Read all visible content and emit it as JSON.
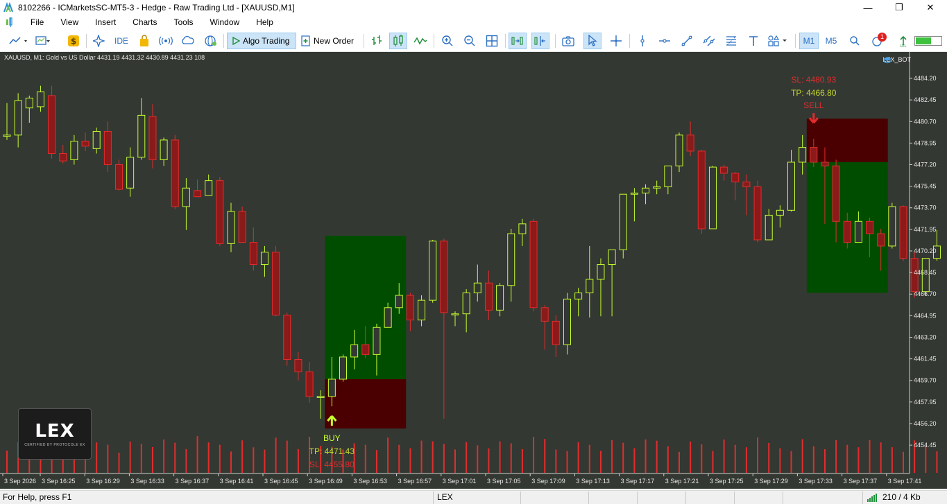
{
  "window": {
    "title": "8102266 - ICMarketsSC-MT5-3 - Hedge - Raw Trading Ltd - [XAUUSD,M1]",
    "minimize": "—",
    "maximize": "❐",
    "close": "✕"
  },
  "menu": {
    "items": [
      "File",
      "View",
      "Insert",
      "Charts",
      "Tools",
      "Window",
      "Help"
    ]
  },
  "toolbar": {
    "ide_label": "IDE",
    "algo_trading_label": "Algo Trading",
    "new_order_label": "New Order",
    "timeframe_m1": "M1",
    "timeframe_m5": "M5",
    "notification_count": "1",
    "accent_active": "#cce4f7"
  },
  "chart": {
    "info": "XAUUSD, M1:  Gold vs US Dollar  4431.19 4431.32 4430.89 4431.23  108",
    "expert_label": "LEX_BOT",
    "logo_word": "LEX",
    "logo_sub": "CERTIFIED BY PROTOCOLE EX",
    "buy_signal": {
      "label": "BUY",
      "tp": "TP: 4471.43",
      "sl": "SL: 4455.80"
    },
    "sell_signal": {
      "label": "SELL",
      "tp": "TP: 4466.80",
      "sl": "SL: 4480.93"
    },
    "colors": {
      "background": "#343832",
      "bull_candle": "#c6ff2f",
      "bear_candle": "#e12d2d",
      "volume": "#e12d2d",
      "profit_zone": "#004d00",
      "loss_zone": "#4a0000"
    }
  },
  "chart_data": {
    "type": "candlestick",
    "symbol": "XAUUSD",
    "timeframe": "M1",
    "ylim": [
      4453.5,
      4485.1
    ],
    "y_ticks": [
      "4484.20",
      "4482.45",
      "4480.70",
      "4478.95",
      "4477.20",
      "4475.45",
      "4473.70",
      "4471.95",
      "4470.20",
      "4468.45",
      "4466.70",
      "4464.95",
      "4463.20",
      "4461.45",
      "4459.70",
      "4457.95",
      "4456.20",
      "4454.45"
    ],
    "x_ticks": [
      "3 Sep 2026",
      "3 Sep 16:25",
      "3 Sep 16:29",
      "3 Sep 16:33",
      "3 Sep 16:37",
      "3 Sep 16:41",
      "3 Sep 16:45",
      "3 Sep 16:49",
      "3 Sep 16:53",
      "3 Sep 16:57",
      "3 Sep 17:01",
      "3 Sep 17:05",
      "3 Sep 17:09",
      "3 Sep 17:13",
      "3 Sep 17:17",
      "3 Sep 17:21",
      "3 Sep 17:25",
      "3 Sep 17:29",
      "3 Sep 17:33",
      "3 Sep 17:37",
      "3 Sep 17:41"
    ],
    "candles": [
      [
        4479.5,
        4482.2,
        4479.2,
        4479.6
      ],
      [
        4479.6,
        4483.0,
        4478.6,
        4482.4
      ],
      [
        4481.8,
        4482.8,
        4480.6,
        4482.6
      ],
      [
        4481.9,
        4483.6,
        4481.5,
        4483.1
      ],
      [
        4482.8,
        4483.6,
        4477.7,
        4478.1
      ],
      [
        4478.1,
        4478.8,
        4477.3,
        4477.5
      ],
      [
        4477.6,
        4479.6,
        4477.2,
        4479.1
      ],
      [
        4479.1,
        4479.8,
        4478.3,
        4478.7
      ],
      [
        4478.5,
        4480.2,
        4478.1,
        4479.9
      ],
      [
        4479.9,
        4480.7,
        4476.6,
        4477.2
      ],
      [
        4477.2,
        4477.6,
        4475.1,
        4475.2
      ],
      [
        4475.3,
        4478.6,
        4474.6,
        4477.8
      ],
      [
        4477.8,
        4482.6,
        4477.6,
        4481.2
      ],
      [
        4481.1,
        4482.1,
        4476.9,
        4477.6
      ],
      [
        4477.6,
        4479.4,
        4477.1,
        4479.2
      ],
      [
        4479.2,
        4479.6,
        4473.6,
        4473.8
      ],
      [
        4473.8,
        4476.1,
        4471.9,
        4475.3
      ],
      [
        4475.1,
        4476.0,
        4474.7,
        4474.6
      ],
      [
        4474.7,
        4476.4,
        4474.7,
        4475.9
      ],
      [
        4475.9,
        4476.2,
        4470.6,
        4470.8
      ],
      [
        4470.8,
        4474.1,
        4470.1,
        4473.4
      ],
      [
        4473.4,
        4473.8,
        4470.9,
        4470.9
      ],
      [
        4470.9,
        4472.1,
        4468.6,
        4469.1
      ],
      [
        4469.1,
        4470.6,
        4468.1,
        4470.1
      ],
      [
        4470.1,
        4470.6,
        4464.9,
        4465.0
      ],
      [
        4465.0,
        4465.2,
        4460.9,
        4461.4
      ],
      [
        4461.4,
        4462.0,
        4459.7,
        4460.4
      ],
      [
        4460.4,
        4461.2,
        4457.9,
        4458.4
      ],
      [
        4458.4,
        4458.9,
        4456.6,
        4458.4
      ],
      [
        4458.4,
        4461.6,
        4457.6,
        4459.8
      ],
      [
        4459.8,
        4461.8,
        4459.6,
        4461.6
      ],
      [
        4461.6,
        4463.8,
        4460.6,
        4462.6
      ],
      [
        4462.6,
        4464.1,
        4461.5,
        4461.8
      ],
      [
        4461.8,
        4464.3,
        4460.1,
        4464.0
      ],
      [
        4464.0,
        4466.0,
        4464.0,
        4465.6
      ],
      [
        4465.6,
        4467.6,
        4465.1,
        4466.6
      ],
      [
        4466.6,
        4466.8,
        4463.7,
        4464.6
      ],
      [
        4464.6,
        4466.6,
        4464.1,
        4466.2
      ],
      [
        4466.2,
        4471.1,
        4466.0,
        4471.0
      ],
      [
        4471.0,
        4471.2,
        4456.6,
        4465.2
      ],
      [
        4465.1,
        4465.3,
        4464.1,
        4465.1
      ],
      [
        4465.1,
        4467.1,
        4463.6,
        4466.8
      ],
      [
        4466.8,
        4469.1,
        4466.1,
        4467.6
      ],
      [
        4467.6,
        4468.6,
        4464.6,
        4465.4
      ],
      [
        4465.4,
        4467.6,
        4464.9,
        4467.4
      ],
      [
        4467.4,
        4472.0,
        4466.1,
        4471.6
      ],
      [
        4471.6,
        4472.8,
        4470.6,
        4472.4
      ],
      [
        4472.6,
        4472.8,
        4465.3,
        4465.6
      ],
      [
        4465.6,
        4465.8,
        4462.2,
        4464.5
      ],
      [
        4464.5,
        4465.0,
        4461.6,
        4462.6
      ],
      [
        4462.6,
        4466.8,
        4461.8,
        4466.3
      ],
      [
        4466.3,
        4467.2,
        4464.9,
        4466.8
      ],
      [
        4466.8,
        4470.6,
        4464.8,
        4467.9
      ],
      [
        4467.9,
        4469.6,
        4464.9,
        4469.1
      ],
      [
        4469.1,
        4469.6,
        4464.9,
        4470.3
      ],
      [
        4470.3,
        4474.8,
        4469.6,
        4474.8
      ],
      [
        4474.8,
        4475.3,
        4472.6,
        4474.9
      ],
      [
        4474.9,
        4475.6,
        4474.0,
        4475.3
      ],
      [
        4475.3,
        4475.9,
        4474.8,
        4475.4
      ],
      [
        4475.4,
        4476.8,
        4474.8,
        4477.1
      ],
      [
        4477.1,
        4479.8,
        4476.6,
        4479.6
      ],
      [
        4479.6,
        4480.7,
        4477.9,
        4478.3
      ],
      [
        4478.3,
        4478.4,
        4471.6,
        4472.0
      ],
      [
        4472.0,
        4477.1,
        4472.0,
        4477.0
      ],
      [
        4477.0,
        4477.2,
        4475.9,
        4476.5
      ],
      [
        4476.5,
        4476.6,
        4474.3,
        4475.8
      ],
      [
        4475.8,
        4476.4,
        4473.1,
        4475.4
      ],
      [
        4475.4,
        4475.9,
        4470.9,
        4471.1
      ],
      [
        4471.1,
        4473.6,
        4471.1,
        4473.1
      ],
      [
        4473.1,
        4473.9,
        4472.1,
        4473.5
      ],
      [
        4473.5,
        4478.4,
        4473.4,
        4477.4
      ],
      [
        4477.4,
        4479.6,
        4476.4,
        4478.6
      ],
      [
        4478.6,
        4479.3,
        4477.0,
        4477.4
      ],
      [
        4477.4,
        4478.6,
        4472.4,
        4477.1
      ],
      [
        4477.1,
        4477.6,
        4470.9,
        4472.6
      ],
      [
        4472.6,
        4473.3,
        4470.4,
        4470.9
      ],
      [
        4470.9,
        4473.4,
        4470.9,
        4472.6
      ],
      [
        4472.6,
        4472.9,
        4469.7,
        4471.6
      ],
      [
        4471.6,
        4472.0,
        4468.6,
        4470.6
      ],
      [
        4470.6,
        4474.1,
        4470.4,
        4473.8
      ],
      [
        4473.8,
        4473.9,
        4469.4,
        4469.6
      ],
      [
        4469.6,
        4470.1,
        4466.4,
        4466.9
      ],
      [
        4466.9,
        4469.6,
        4466.6,
        4469.6
      ],
      [
        4469.6,
        4471.9,
        4469.4,
        4470.6
      ]
    ],
    "volumes": [
      55,
      52,
      60,
      58,
      48,
      50,
      52,
      56,
      54,
      58,
      50,
      53,
      57,
      60,
      54,
      56,
      52,
      57,
      54,
      58,
      53,
      55,
      50,
      54,
      57,
      60,
      52,
      56,
      48,
      54,
      58,
      50,
      55,
      53,
      57,
      52,
      54,
      50,
      56,
      60,
      58,
      52,
      54,
      57,
      51,
      55,
      52,
      56,
      60,
      48,
      54,
      52,
      55,
      51,
      53,
      56,
      54,
      52,
      57,
      55,
      52,
      53,
      56,
      51,
      54,
      52,
      56,
      55,
      53,
      51,
      54,
      57,
      52,
      55,
      53,
      52,
      56,
      51,
      54,
      53,
      52,
      55,
      54,
      50
    ],
    "buy_zone": {
      "start_index": 29,
      "end_index": 35,
      "entry": 4459.8,
      "tp": 4471.43,
      "sl": 4455.8
    },
    "sell_zone": {
      "start_index": 72,
      "end_index": 78,
      "entry": 4477.4,
      "tp": 4466.8,
      "sl": 4480.93
    },
    "grid": false,
    "legend": "none"
  },
  "status": {
    "help": "For Help, press F1",
    "profile": "LEX",
    "traffic": "210 / 4 Kb"
  }
}
